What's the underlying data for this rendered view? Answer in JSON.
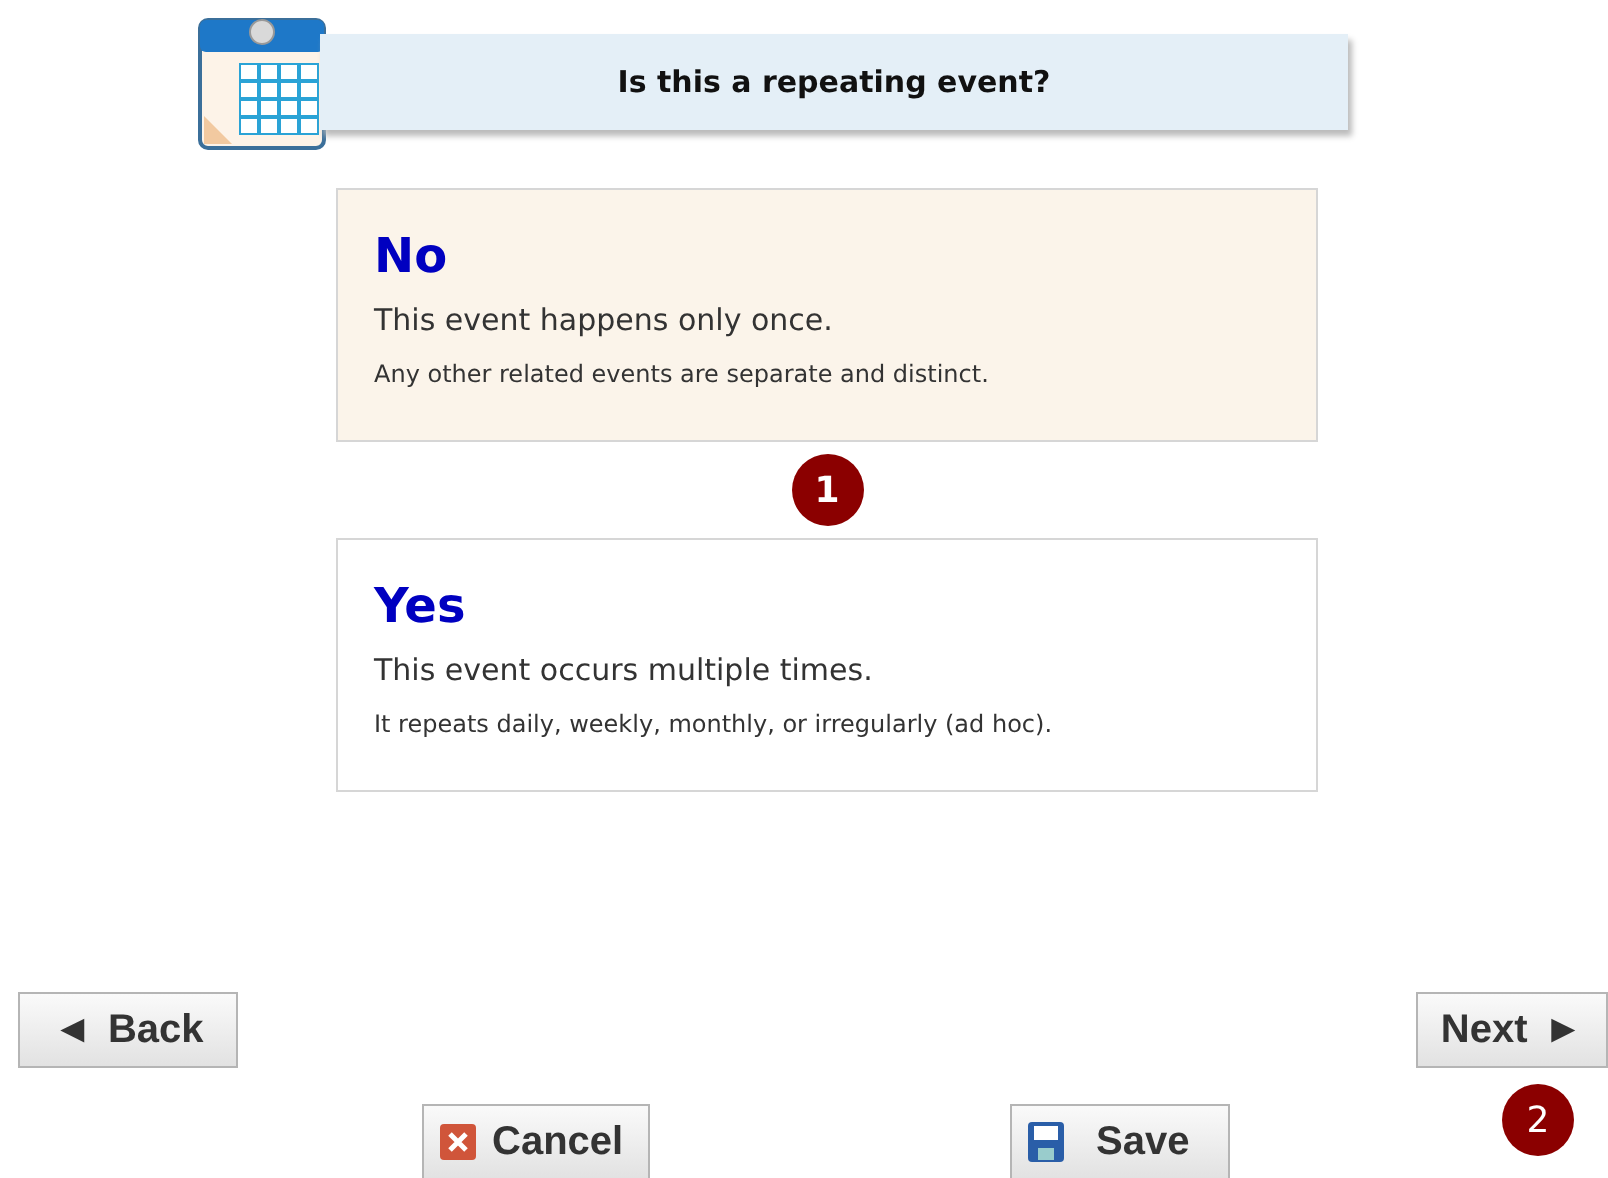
{
  "header": {
    "title": "Is this a repeating event?"
  },
  "options": [
    {
      "title": "No",
      "line": "This event happens only once.",
      "note": "Any other related events are separate and distinct.",
      "selected": true
    },
    {
      "title": "Yes",
      "line": "This event occurs multiple times.",
      "note": "It repeats daily, weekly, monthly, or irregularly (ad hoc).",
      "selected": false
    }
  ],
  "step_badges": [
    "1",
    "2"
  ],
  "nav": {
    "back": {
      "arrow": "◄",
      "label": "Back"
    },
    "next": {
      "arrow": "►",
      "label": "Next"
    }
  },
  "actions": {
    "cancel": "Cancel",
    "save": "Save"
  }
}
